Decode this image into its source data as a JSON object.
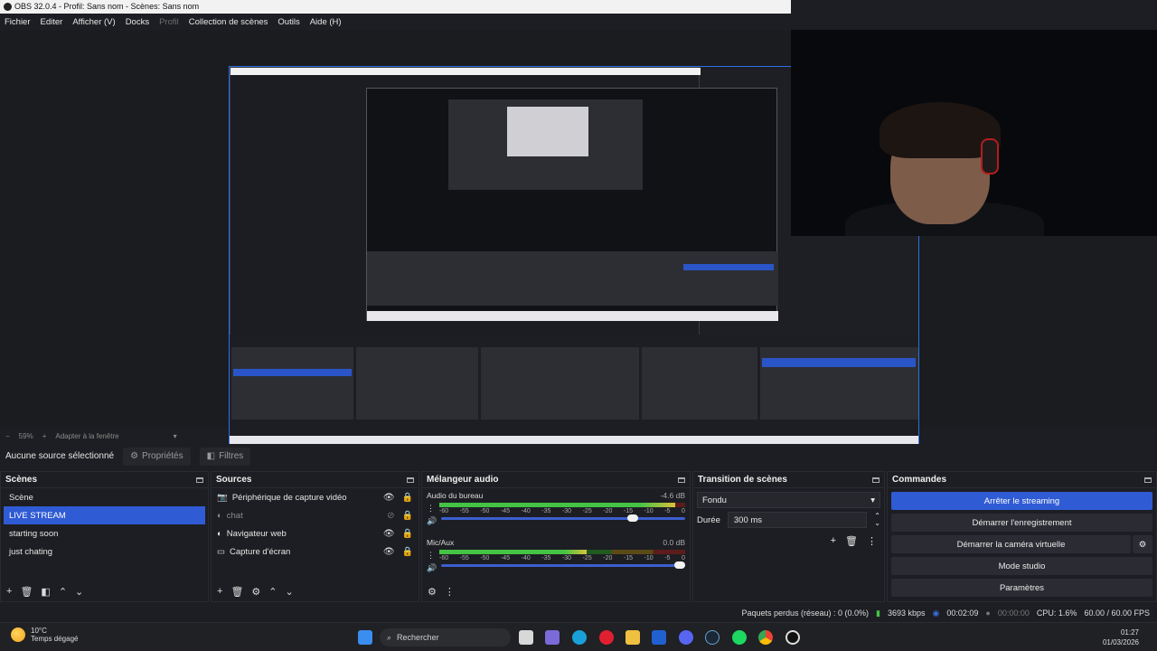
{
  "window": {
    "title": "OBS 32.0.4 - Profil: Sans nom - Scènes: Sans nom"
  },
  "menu": {
    "items": [
      "Fichier",
      "Editer",
      "Afficher (V)",
      "Docks",
      "Profil",
      "Collection de scènes",
      "Outils",
      "Aide (H)"
    ]
  },
  "zoom": {
    "minus": "−",
    "value": "59%",
    "plus": "+",
    "fit": "Adapter à la fenêtre"
  },
  "context": {
    "no_source": "Aucune source sélectionné",
    "properties": "Propriétés",
    "filters": "Filtres"
  },
  "scenes": {
    "title": "Scènes",
    "items": [
      "Scène",
      "LIVE STREAM",
      "starting soon",
      "just chating"
    ],
    "selected": 1
  },
  "sources": {
    "title": "Sources",
    "items": [
      {
        "label": "Périphérique de capture vidéo",
        "icon": "camera-icon",
        "visible": true
      },
      {
        "label": "chat",
        "icon": "globe-icon",
        "visible": false
      },
      {
        "label": "Navigateur web",
        "icon": "globe-icon",
        "visible": true
      },
      {
        "label": "Capture d'écran",
        "icon": "monitor-icon",
        "visible": true
      }
    ]
  },
  "mixer": {
    "title": "Mélangeur audio",
    "channels": [
      {
        "name": "Audio du bureau",
        "db": "-4.6 dB",
        "level": 0.96,
        "volume": 0.8
      },
      {
        "name": "Mic/Aux",
        "db": "0.0 dB",
        "level": 0.6,
        "volume": 1.0
      }
    ],
    "ticks": [
      "-60",
      "-55",
      "-50",
      "-45",
      "-40",
      "-35",
      "-30",
      "-25",
      "-20",
      "-15",
      "-10",
      "-5",
      "0"
    ]
  },
  "transitions": {
    "title": "Transition de scènes",
    "selected": "Fondu",
    "duration_label": "Durée",
    "duration": "300 ms"
  },
  "commands": {
    "title": "Commandes",
    "buttons": [
      "Arrêter le streaming",
      "Démarrer l'enregistrement",
      "Démarrer la caméra virtuelle",
      "Mode studio",
      "Paramètres"
    ]
  },
  "status": {
    "dropped": "Paquets perdus (réseau) : 0 (0.0%)",
    "bitrate": "3693 kbps",
    "stream_time": "00:02:09",
    "rec_time": "00:00:00",
    "cpu": "CPU: 1.6%",
    "fps": "60.00 / 60.00 FPS"
  },
  "taskbar": {
    "temp": "10°C",
    "weather": "Temps dégagé",
    "search": "Rechercher",
    "time": "01:27",
    "date": "01/03/2026"
  },
  "colors": {
    "accent": "#2f5bd4",
    "border_accent": "#2e6ee6"
  }
}
